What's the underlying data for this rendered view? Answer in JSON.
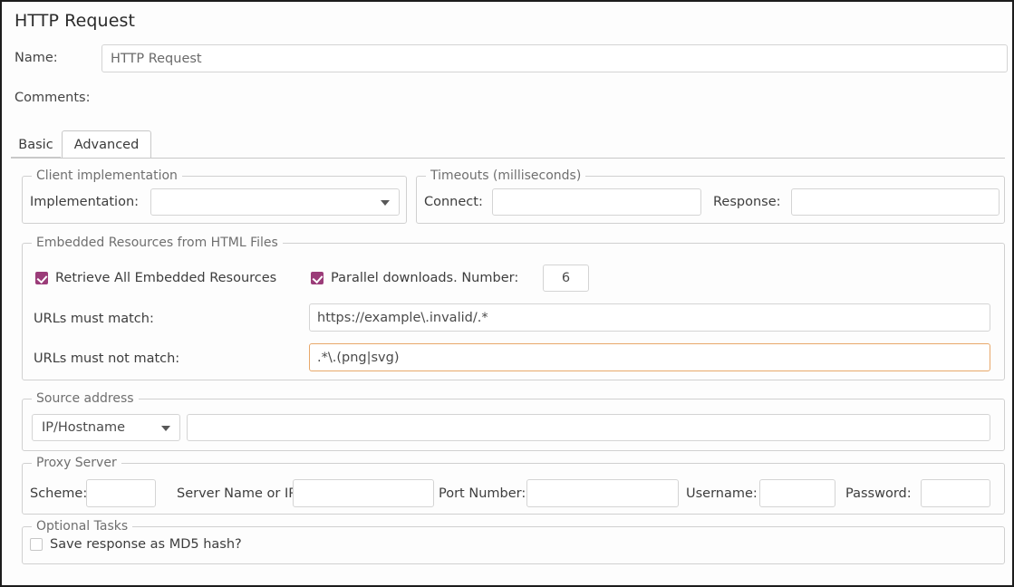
{
  "window": {
    "title": "HTTP Request"
  },
  "header": {
    "name_label": "Name:",
    "name_value": "HTTP Request",
    "name_placeholder": "",
    "comments_label": "Comments:",
    "comments_value": "",
    "comments_placeholder": ""
  },
  "tabs": [
    {
      "label": "Basic",
      "selected": false
    },
    {
      "label": "Advanced",
      "selected": true
    }
  ],
  "client_implementation": {
    "legend": "Client implementation",
    "implementation_label": "Implementation:",
    "implementation_value": ""
  },
  "timeouts": {
    "legend": "Timeouts (milliseconds)",
    "connect_label": "Connect:",
    "connect_value": "",
    "response_label": "Response:",
    "response_value": ""
  },
  "embedded_resources": {
    "legend": "Embedded Resources from HTML Files",
    "retrieve_all_label": "Retrieve All Embedded Resources",
    "retrieve_all_checked": true,
    "parallel_label": "Parallel downloads. Number:",
    "parallel_checked": true,
    "parallel_number": "6",
    "urls_match_label": "URLs must match:",
    "urls_match_value": "https://example\\.invalid/.*",
    "urls_not_match_label": "URLs must not match:",
    "urls_not_match_value": ".*\\.(png|svg)",
    "urls_not_match_focused": true
  },
  "source_address": {
    "legend": "Source address",
    "type_value": "IP/Hostname",
    "address_value": ""
  },
  "proxy_server": {
    "legend": "Proxy Server",
    "scheme_label": "Scheme:",
    "scheme_value": "",
    "server_label": "Server Name or IP:",
    "server_value": "",
    "port_label": "Port Number:",
    "port_value": "",
    "username_label": "Username:",
    "username_value": "",
    "password_label": "Password:",
    "password_value": ""
  },
  "optional_tasks": {
    "legend": "Optional Tasks",
    "md5_label": "Save response as MD5 hash?",
    "md5_checked": false
  },
  "colors": {
    "checkbox_accent": "#9b3c79",
    "focus_border": "#e8a86a",
    "border": "#d0d0d0"
  }
}
